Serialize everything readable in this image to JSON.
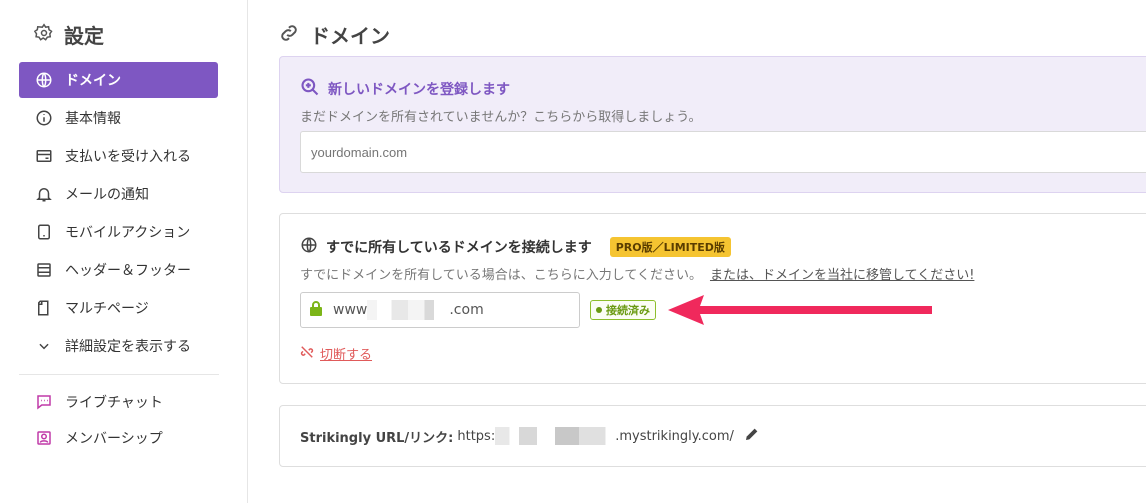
{
  "sidebar": {
    "title": "設定",
    "items": [
      {
        "label": "ドメイン",
        "icon": "globe-icon",
        "active": true
      },
      {
        "label": "基本情報",
        "icon": "info-icon"
      },
      {
        "label": "支払いを受け入れる",
        "icon": "payment-icon"
      },
      {
        "label": "メールの通知",
        "icon": "bell-icon"
      },
      {
        "label": "モバイルアクション",
        "icon": "mobile-icon"
      },
      {
        "label": "ヘッダー＆フッター",
        "icon": "header-footer-icon"
      },
      {
        "label": "マルチページ",
        "icon": "pages-icon"
      },
      {
        "label": "詳細設定を表示する",
        "icon": "chevron-down-icon"
      }
    ],
    "extras": [
      {
        "label": "ライブチャット",
        "icon": "chat-icon"
      },
      {
        "label": "メンバーシップ",
        "icon": "membership-icon"
      }
    ]
  },
  "main": {
    "title": "ドメイン",
    "register": {
      "title": "新しいドメインを登録します",
      "subtitle": "まだドメインを所有されていませんか？こちらから取得しましょう。",
      "placeholder": "yourdomain.com"
    },
    "connect": {
      "title": "すでに所有しているドメインを接続します",
      "badge": "PRO版／LIMITED版",
      "subtitle": "すでにドメインを所有している場合は、こちらに入力してください。",
      "transfer_link": "または、ドメインを当社に移管してください!",
      "domain_prefix": "www",
      "domain_suffix": ".com",
      "status": "接続済み",
      "disconnect": "切断する"
    },
    "url": {
      "label": "Strikingly URL/リンク:",
      "prefix": "https:",
      "suffix": ".mystrikingly.com/"
    }
  },
  "colors": {
    "accent": "#7e57c2",
    "pro_badge": "#f5c431",
    "connected": "#8dbe2c",
    "disconnect": "#e05a5a",
    "arrow": "#f0295c"
  }
}
